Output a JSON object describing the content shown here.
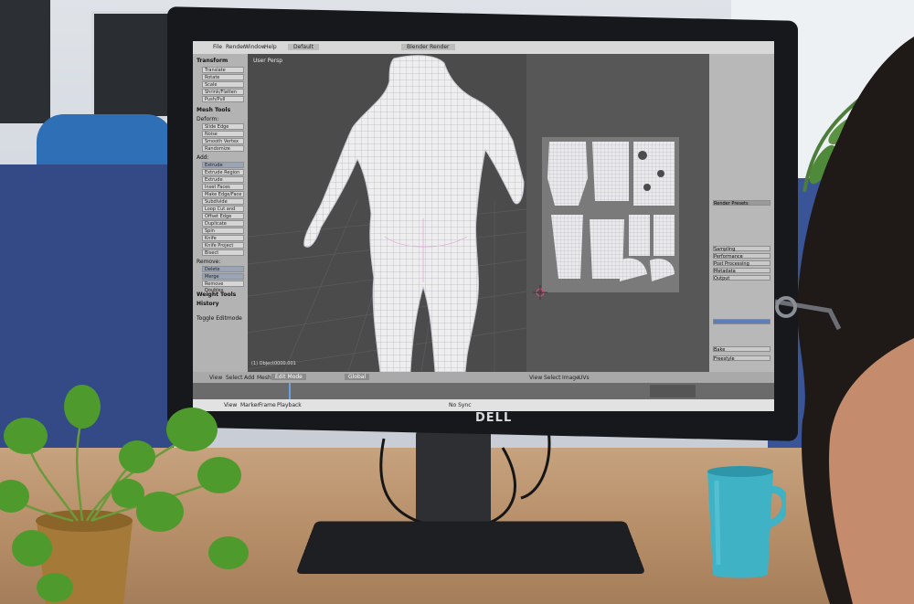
{
  "monitor": {
    "brand": "DELL"
  },
  "blender": {
    "menu": [
      "File",
      "Render",
      "Window",
      "Help"
    ],
    "layout": "Default",
    "engine": "Blender Render",
    "viewport_label": "User Persp",
    "toolbar": {
      "transform_header": "Transform",
      "transform_tools": [
        "Translate",
        "Rotate",
        "Scale",
        "Shrink/Flatten",
        "Push/Pull"
      ],
      "mesh_tools_header": "Mesh Tools",
      "deform_label": "Deform:",
      "deform_tools": [
        "Slide Edge",
        "Noise",
        "Smooth Vertex",
        "Randomize"
      ],
      "add_label": "Add:",
      "add_tools": [
        "Extrude",
        "Extrude Region",
        "Extrude Individual",
        "Inset Faces",
        "Make Edge/Face",
        "Subdivide",
        "Loop Cut and Slide",
        "Offset Edge Slide",
        "Duplicate",
        "Spin",
        "Knife",
        "Knife Project",
        "Bisect"
      ],
      "remove_label": "Remove:",
      "remove_tools": [
        "Delete",
        "Merge",
        "Remove Doubles"
      ],
      "weight_tools": "Weight Tools",
      "history": "History",
      "toggle_label": "Toggle Editmode"
    },
    "bottom": {
      "menus": [
        "View",
        "Select",
        "Add",
        "Mesh"
      ],
      "mode": "Edit Mode",
      "pivot": "Global",
      "uv_menus": [
        "View",
        "Select",
        "Image",
        "UVs"
      ]
    },
    "timeline": {
      "menus": [
        "View",
        "Marker",
        "Frame",
        "Playback"
      ],
      "sync": "No Sync"
    },
    "properties": {
      "panels": [
        "Render Presets",
        "Sampling",
        "Performance",
        "Post Processing",
        "Metadata",
        "Output",
        "Bake",
        "Freestyle"
      ]
    },
    "status_object": "(1) Object0000.001"
  }
}
